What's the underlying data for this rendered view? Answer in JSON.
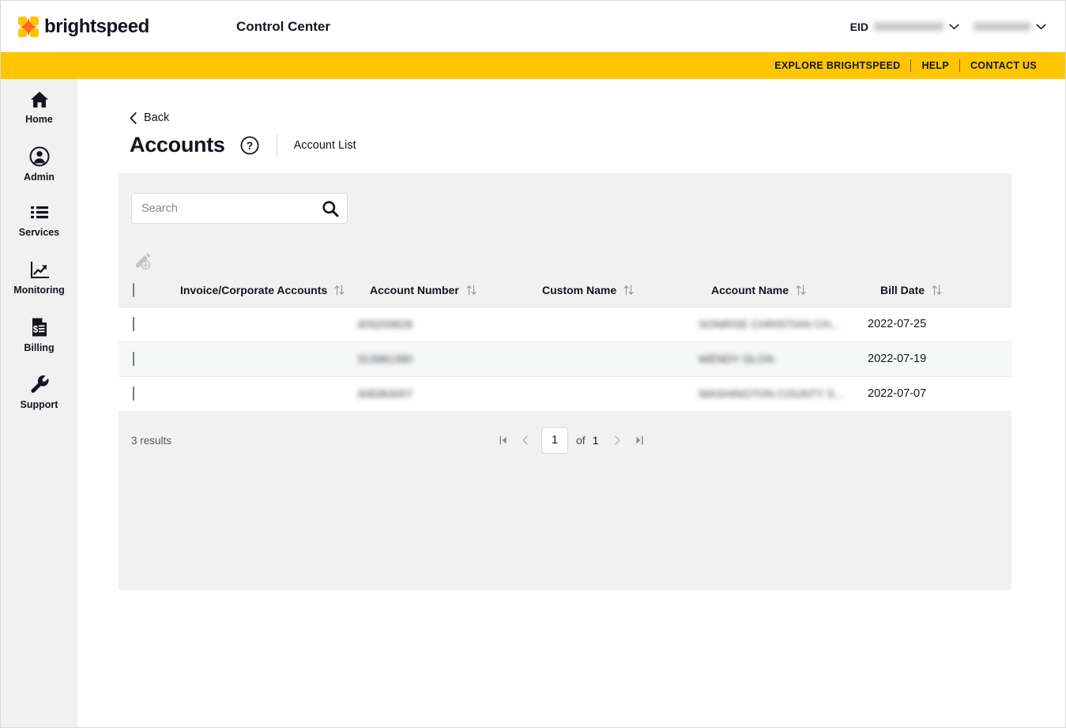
{
  "header": {
    "brand_name": "brightspeed",
    "logo_icon": "brightspeed-sparkle-logo",
    "app_title": "Control Center",
    "eid_label": "EID",
    "eid_value": "",
    "eid_chevron_icon": "chevron-down-icon",
    "user_value": "",
    "user_chevron_icon": "chevron-down-icon"
  },
  "utility_bar": {
    "links": [
      {
        "label": "EXPLORE BRIGHTSPEED"
      },
      {
        "label": "HELP"
      },
      {
        "label": "CONTACT US"
      }
    ]
  },
  "sidebar": {
    "items": [
      {
        "label": "Home",
        "icon": "home-icon"
      },
      {
        "label": "Admin",
        "icon": "user-circle-icon"
      },
      {
        "label": "Services",
        "icon": "list-icon"
      },
      {
        "label": "Monitoring",
        "icon": "chart-trend-icon"
      },
      {
        "label": "Billing",
        "icon": "invoice-dollar-icon"
      },
      {
        "label": "Support",
        "icon": "wrench-icon"
      }
    ]
  },
  "page": {
    "back_label": "Back",
    "back_icon": "chevron-left-icon",
    "title": "Accounts",
    "help_icon": "question-circle-icon",
    "breadcrumb_current": "Account List"
  },
  "search": {
    "value": "",
    "placeholder": "Search",
    "icon": "search-icon"
  },
  "toolbar": {
    "edit_icon": "pencil-add-icon",
    "edit_disabled": true
  },
  "table": {
    "select_all_checkbox": "unchecked",
    "sort_icon": "sort-updown-icon",
    "columns": [
      {
        "key": "checkbox",
        "label": "",
        "sortable": false
      },
      {
        "key": "invoice",
        "label": "Invoice/Corporate Accounts",
        "sortable": true
      },
      {
        "key": "account_number",
        "label": "Account Number",
        "sortable": true
      },
      {
        "key": "custom_name",
        "label": "Custom Name",
        "sortable": true
      },
      {
        "key": "account_name",
        "label": "Account Name",
        "sortable": true
      },
      {
        "key": "bill_date",
        "label": "Bill Date",
        "sortable": true
      }
    ],
    "rows": [
      {
        "checked": false,
        "invoice": "",
        "account_number": "409209628",
        "account_number_redacted": true,
        "custom_name": "",
        "account_name": "SONRISE CHRISTIAN CH...",
        "account_name_redacted": true,
        "bill_date": "2022-07-25"
      },
      {
        "checked": false,
        "invoice": "",
        "account_number": "313981390",
        "account_number_redacted": true,
        "custom_name": "",
        "account_name": "WENDY GLON",
        "account_name_redacted": true,
        "bill_date": "2022-07-19"
      },
      {
        "checked": false,
        "invoice": "",
        "account_number": "308363007",
        "account_number_redacted": true,
        "custom_name": "",
        "account_name": "WASHINGTON COUNTY S...",
        "account_name_redacted": true,
        "bill_date": "2022-07-07"
      }
    ]
  },
  "pagination": {
    "results_text": "3 results",
    "first_icon": "page-first-icon",
    "prev_icon": "page-prev-icon",
    "current_page": "1",
    "of_label": "of",
    "total_pages": "1",
    "next_icon": "page-next-icon",
    "last_icon": "page-last-icon"
  },
  "colors": {
    "brand_yellow": "#ffc600",
    "brand_orange": "#ff6b1a",
    "ink": "#14141e",
    "panel_grey": "#f1f1f1"
  }
}
